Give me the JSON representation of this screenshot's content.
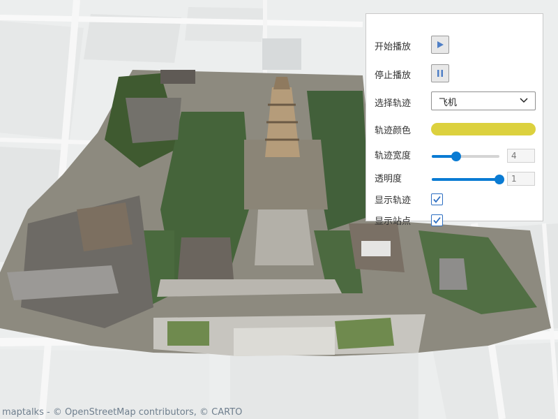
{
  "map": {
    "view": "3D tileset of temple complex with pagoda",
    "basemap_colors": {
      "ground": "#eceeee",
      "roads": "#f8f8f8",
      "blocks": "#e2e4e4"
    }
  },
  "panel": {
    "start_play_label": "开始播放",
    "stop_play_label": "停止播放",
    "select_track_label": "选择轨迹",
    "track_options_selected": "飞机",
    "track_color_label": "轨迹颜色",
    "track_color": "#dcd13e",
    "track_width_label": "轨迹宽度",
    "track_width_value": "4",
    "track_width_fraction": 0.36,
    "opacity_label": "透明度",
    "opacity_value": "1",
    "opacity_fraction": 1.0,
    "show_track_label": "显示轨迹",
    "show_track_checked": true,
    "show_stations_label": "显示站点",
    "show_stations_checked": true
  },
  "attribution": "maptalks - © OpenStreetMap contributors, © CARTO"
}
